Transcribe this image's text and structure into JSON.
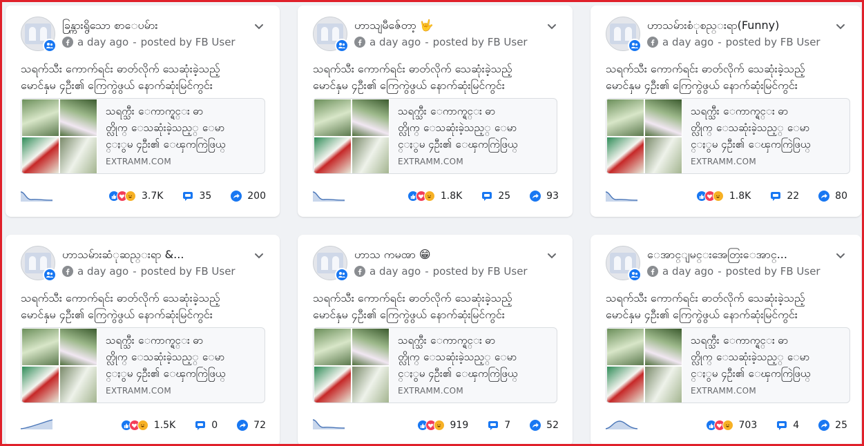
{
  "colors": {
    "accent": "#1877f2",
    "frame": "#e0202a",
    "muted": "#65676b"
  },
  "posts": [
    {
      "page_name": "ခြန္ကားရွိသော စာေပမ်ား",
      "time": "a day ago",
      "posted_by": "posted by FB User",
      "text_line1": "သရက်သီး ကောက်ရင်း ဓာတ်လိုက် သေဆုံးခဲ့သည့်",
      "text_line2": "မောင်နှမ ၄ဦး၏ ကြေကွဲဖွယ် နောက်ဆုံးမြင်ကွင်း",
      "link_line1": "သရက္သီး ေကာက္ရင္း ဓာ",
      "link_line2": "တ္လိုက္ ေသဆုံးခဲ့သည့္ ေမာ",
      "link_line3": "င္ႏွမ ၄ဦး၏ ေၾကကြဲဖြယ္",
      "domain": "EXTRAMM.COM",
      "reactions": "3.7K",
      "comments": "35",
      "shares": "200",
      "trend": "down"
    },
    {
      "page_name": "ဟာသျမီဇ်ေတာ့ 🤟",
      "time": "a day ago",
      "posted_by": "posted by FB User",
      "text_line1": "သရက်သီး ကောက်ရင်း ဓာတ်လိုက် သေဆုံးခဲ့သည့်",
      "text_line2": "မောင်နှမ ၄ဦး၏ ကြေကွဲဖွယ် နောက်ဆုံးမြင်ကွင်း",
      "link_line1": "သရက္သီး ေကာက္ရင္း ဓာ",
      "link_line2": "တ္လိုက္ ေသဆုံးခဲ့သည့္ ေမာ",
      "link_line3": "င္ႏွမ ၄ဦး၏ ေၾကကြဲဖြယ္",
      "domain": "EXTRAMM.COM",
      "reactions": "1.8K",
      "comments": "25",
      "shares": "93",
      "trend": "down"
    },
    {
      "page_name": "ဟာသမ်ားစံုစည္းရာ(Funny)",
      "time": "a day ago",
      "posted_by": "posted by FB User",
      "text_line1": "သရက်သီး ကောက်ရင်း ဓာတ်လိုက် သေဆုံးခဲ့သည့်",
      "text_line2": "မောင်နှမ ၄ဦး၏ ကြေကွဲဖွယ် နောက်ဆုံးမြင်ကွင်း",
      "link_line1": "သရက္သီး ေကာက္ရင္း ဓာ",
      "link_line2": "တ္လိုက္ ေသဆုံးခဲ့သည့္ ေမာ",
      "link_line3": "င္ႏွမ ၄ဦး၏ ေၾကကြဲဖြယ္",
      "domain": "EXTRAMM.COM",
      "reactions": "1.8K",
      "comments": "22",
      "shares": "80",
      "trend": "down"
    },
    {
      "page_name": "ဟာသမ်ားဆံုဆည္းရာ &...",
      "time": "a day ago",
      "posted_by": "posted by FB User",
      "text_line1": "သရက်သီး ကောက်ရင်း ဓာတ်လိုက် သေဆုံးခဲ့သည့်",
      "text_line2": "မောင်နှမ ၄ဦး၏ ကြေကွဲဖွယ် နောက်ဆုံးမြင်ကွင်း",
      "link_line1": "သရက္သီး ေကာက္ရင္း ဓာ",
      "link_line2": "တ္လိုက္ ေသဆုံးခဲ့သည့္ ေမာ",
      "link_line3": "င္ႏွမ ၄ဦး၏ ေၾကကြဲဖြယ္",
      "domain": "EXTRAMM.COM",
      "reactions": "1.5K",
      "comments": "0",
      "shares": "72",
      "trend": "up"
    },
    {
      "page_name": "ဟာသ ကမၻာ 😁",
      "time": "a day ago",
      "posted_by": "posted by FB User",
      "text_line1": "သရက်သီး ကောက်ရင်း ဓာတ်လိုက် သေဆုံးခဲ့သည့်",
      "text_line2": "မောင်နှမ ၄ဦး၏ ကြေကွဲဖွယ် နောက်ဆုံးမြင်ကွင်း",
      "link_line1": "သရက္သီး ေကာက္ရင္း ဓာ",
      "link_line2": "တ္လိုက္ ေသဆုံးခဲ့သည့္ ေမာ",
      "link_line3": "င္ႏွမ ၄ဦး၏ ေၾကကြဲဖြယ္",
      "domain": "EXTRAMM.COM",
      "reactions": "919",
      "comments": "7",
      "shares": "52",
      "trend": "down"
    },
    {
      "page_name": "ေအာင္ျမင္းအေတြးေအာင္...",
      "time": "a day ago",
      "posted_by": "posted by FB User",
      "text_line1": "သရက်သီး ကောက်ရင်း ဓာတ်လိုက် သေဆုံးခဲ့သည့်",
      "text_line2": "မောင်နှမ ၄ဦး၏ ကြေကွဲဖွယ် နောက်ဆုံးမြင်ကွင်း",
      "link_line1": "သရက္သီး ေကာက္ရင္း ဓာ",
      "link_line2": "တ္လိုက္ ေသဆုံးခဲ့သည့္ ေမာ",
      "link_line3": "င္ႏွမ ၄ဦး၏ ေၾကကြဲဖြယ္",
      "domain": "EXTRAMM.COM",
      "reactions": "703",
      "comments": "4",
      "shares": "25",
      "trend": "hump"
    }
  ]
}
